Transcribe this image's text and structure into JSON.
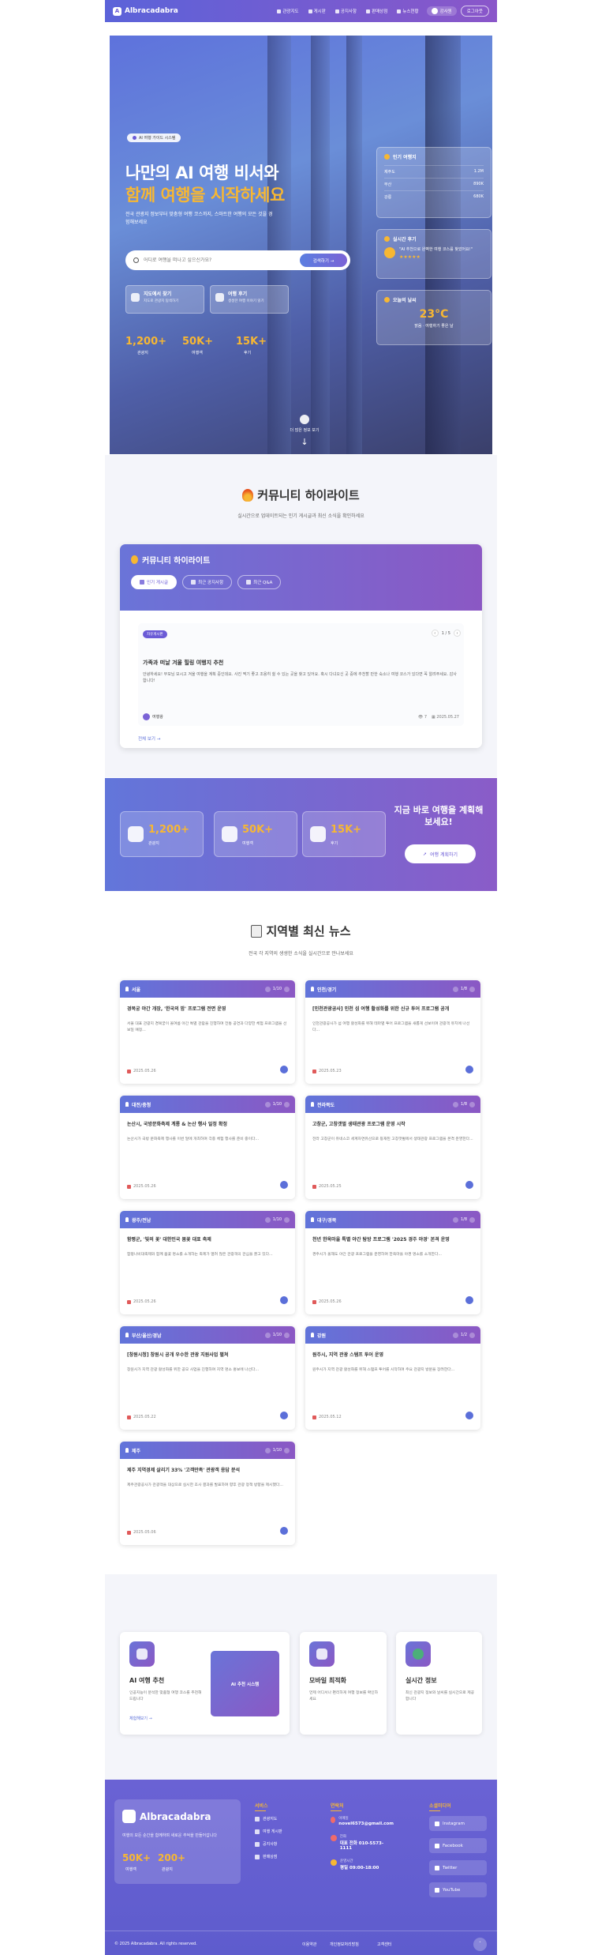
{
  "nav": {
    "brand": "Albracadabra",
    "links": [
      "관광지도",
      "게시판",
      "공지사항",
      "판매상점",
      "뉴스현황"
    ],
    "user": "강사원",
    "logout": "로그아웃"
  },
  "hero": {
    "badge": "AI 여행 가이드 시스템",
    "title1": "나만의 AI 여행 비서와",
    "title2": "함께 여행을 시작하세요",
    "sub": "전국 관광지 정보부터 맞춤형 여행 코스까지, 스마트한 여행의 모든 것을 경험해보세요",
    "search_placeholder": "어디로 여행을 떠나고 싶으신가요?",
    "search_btn": "검색하기 →",
    "quick": [
      {
        "title": "지도에서 찾기",
        "desc": "지도로 관광지 탐색하기"
      },
      {
        "title": "여행 후기",
        "desc": "생생한 여행 이야기 읽기"
      }
    ],
    "stats": [
      {
        "v": "1,200+",
        "l": "관광지"
      },
      {
        "v": "50K+",
        "l": "여행객"
      },
      {
        "v": "15K+",
        "l": "후기"
      }
    ],
    "popular": {
      "title": "인기 여행지",
      "rows": [
        {
          "k": "제주도",
          "v": "1.2M"
        },
        {
          "k": "부산",
          "v": "890K"
        },
        {
          "k": "강릉",
          "v": "680K"
        }
      ]
    },
    "review": {
      "title": "실시간 후기",
      "text": "\"AI 추천으로 완벽한 여행 코스를 찾았어요!\"",
      "stars": "★★★★★"
    },
    "weather": {
      "title": "오늘의 날씨",
      "temp": "23°C",
      "desc": "맑음 · 여행하기 좋은 날"
    },
    "scroll": "더 많은 정보 보기"
  },
  "community": {
    "title": "커뮤니티 하이라이트",
    "sub": "실시간으로 업데이트되는 인기 게시글과 최신 소식을 확인하세요",
    "card_title": "커뮤니티 하이라이트",
    "tabs": [
      "인기 게시글",
      "최근 공지사항",
      "최근 Q&A"
    ],
    "post": {
      "badge": "자유게시판",
      "page": "1 / 5",
      "title": "가족과 떠날 겨울 힐링 여행지 추천",
      "body": "안녕하세요! 부모님 모시고 겨울 여행을 계획 중인데요. 사진 찍기 좋고 조용히 쉴 수 있는 곳을 찾고 있어요. 혹시 다녀오신 곳 중에 추천할 만한 숙소나 여행 코스가 있다면 꼭 알려주세요. 감사합니다!",
      "author": "여행왕",
      "views": "7",
      "date": "2025.05.27"
    },
    "more": "전체 보기 →"
  },
  "band": {
    "stats": [
      {
        "v": "1,200+",
        "l": "관광지"
      },
      {
        "v": "50K+",
        "l": "여행객"
      },
      {
        "v": "15K+",
        "l": "후기"
      }
    ],
    "cta": "지금 바로 여행을 계획해보세요!",
    "btn": "여행 계획하기"
  },
  "news": {
    "title": "지역별 최신 뉴스",
    "sub": "전국 각 지역의 생생한 소식을 실시간으로 만나보세요",
    "items": [
      {
        "region": "서울",
        "page": "1/10",
        "title": "경복궁 야간 개장, '한국의 밤' 프로그램 전면 운영",
        "body": "서울 대표 관광지 경복궁이 올여름 야간 특별 관람을 진행하며 전통 공연과 다양한 체험 프로그램을 선보일 예정...",
        "date": "2025.05.26"
      },
      {
        "region": "인천/경기",
        "page": "1/8",
        "title": "[인천관광공사] 인천 섬 여행 활성화를 위한 신규 투어 프로그램 공개",
        "body": "인천관광공사가 섬 여행 활성화를 위해 테마별 투어 프로그램을 새롭게 선보이며 관광객 유치에 나선다...",
        "date": "2025.05.23"
      },
      {
        "region": "대전/충청",
        "page": "1/10",
        "title": "논산시, 국방문화축제 계룡 & 논산 행사 일정 확정",
        "body": "논산시가 국방 문화축제 행사를 이번 달에 개최하며 각종 체험 행사를 준비 중이다...",
        "date": "2025.05.26"
      },
      {
        "region": "전라북도",
        "page": "1/8",
        "title": "고창군, 고창갯벌 생태관광 프로그램 운영 시작",
        "body": "전라 고창군이 유네스코 세계자연유산으로 등재된 고창갯벌에서 생태관광 프로그램을 본격 운영한다...",
        "date": "2025.05.25"
      },
      {
        "region": "광주/전남",
        "page": "1/10",
        "title": "함평군, '빛의 꽃' 대한민국 봄꽃 대표 축제",
        "body": "함평나비대축제와 함께 봄꽃 명소를 소개하는 축제가 열려 많은 관광객의 관심을 끌고 있다...",
        "date": "2025.05.26"
      },
      {
        "region": "대구/경북",
        "page": "1/8",
        "title": "천년 한옥마을 특별 야간 탐방 프로그램 '2025 경주 야경' 본격 운영",
        "body": "경주시가 올해도 야간 관광 프로그램을 운영하며 한옥마을 야경 명소를 소개한다...",
        "date": "2025.05.26"
      },
      {
        "region": "부산/울산/경남",
        "page": "1/10",
        "title": "[창원시청] 창원시 공개 우수한 관광 지원사업 펼쳐",
        "body": "창원시가 지역 관광 활성화를 위한 공모 사업을 진행하며 지역 명소 홍보에 나선다...",
        "date": "2025.05.22"
      },
      {
        "region": "강원",
        "page": "1/2",
        "title": "원주시, 지역 관광 스탬프 투어 운영",
        "body": "원주시가 지역 관광 활성화를 위해 스탬프 투어를 시작하며 주요 관광지 방문을 장려한다...",
        "date": "2025.05.12"
      },
      {
        "region": "제주",
        "page": "1/10",
        "title": "제주 지역경제 살리기 33% '고객만족' 관광객 응답 분석",
        "body": "제주관광공사가 관광객을 대상으로 실시한 조사 결과를 발표하며 향후 관광 정책 방향을 제시했다...",
        "date": "2025.05.06"
      }
    ]
  },
  "features": [
    {
      "title": "AI 여행 추천",
      "desc": "인공지능이 분석한 맞춤형 여행 코스를 추천해드립니다",
      "link": "체험해보기 →",
      "preview": "AI 추천 시스템"
    },
    {
      "title": "모바일 최적화",
      "desc": "언제 어디서나 편리하게 여행 정보를 확인하세요"
    },
    {
      "title": "실시간 정보",
      "desc": "최신 관광지 정보와 날씨를 실시간으로 제공합니다"
    }
  ],
  "footer": {
    "brand": "Albracadabra",
    "desc": "여행의 모든 순간을 함께하며 새로운 추억을 만들어갑니다",
    "stats": [
      {
        "v": "50K+",
        "l": "여행객"
      },
      {
        "v": "200+",
        "l": "관광지"
      }
    ],
    "services_title": "서비스",
    "services": [
      "관광지도",
      "여행 게시판",
      "공지사항",
      "판매상점"
    ],
    "contact_title": "연락처",
    "contacts": [
      {
        "k": "이메일",
        "v": "novel6573@gmail.com"
      },
      {
        "k": "전화",
        "v": "대표 전화 010-5573-1111"
      },
      {
        "k": "운영시간",
        "v": "평일 09:00-18:00"
      }
    ],
    "social_title": "소셜미디어",
    "socials": [
      "Instagram",
      "Facebook",
      "Twitter",
      "YouTube"
    ],
    "copy": "© 2025 Albracadabra. All rights reserved.",
    "links": [
      "이용약관",
      "개인정보처리방침",
      "고객센터"
    ]
  }
}
